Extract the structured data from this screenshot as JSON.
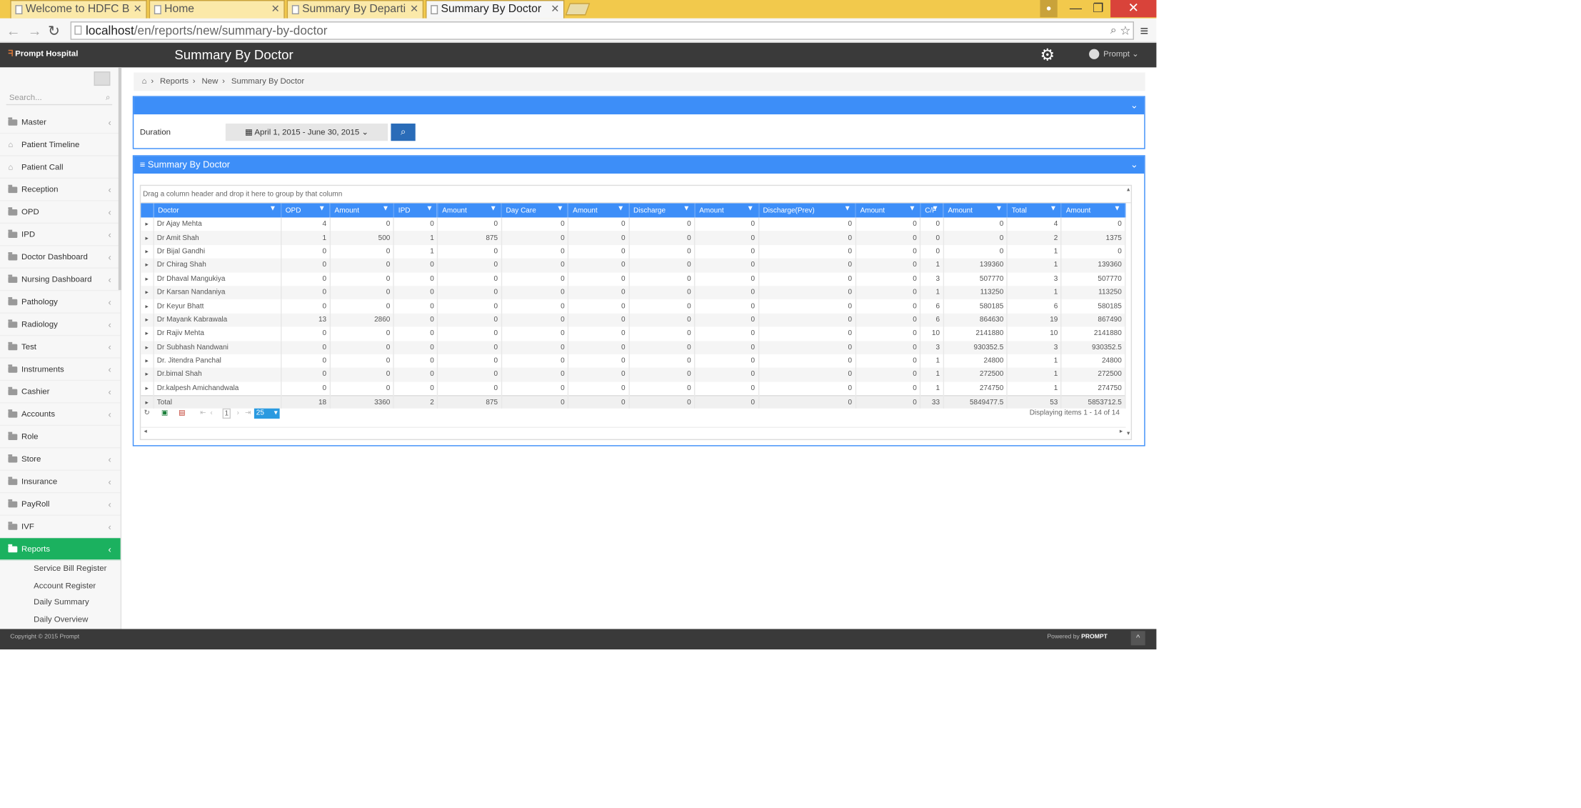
{
  "browser": {
    "tabs": [
      {
        "label": "Welcome to HDFC B"
      },
      {
        "label": "Home"
      },
      {
        "label": "Summary By Departi"
      },
      {
        "label": "Summary By Doctor"
      }
    ],
    "url_host": "localhost",
    "url_path": "/en/reports/new/summary-by-doctor"
  },
  "header": {
    "logo": "Prompt Hospital",
    "title": "Summary By Doctor",
    "user": "Prompt"
  },
  "sidebar": {
    "search_placeholder": "Search...",
    "items": [
      {
        "label": "Master",
        "icon": "folder-icon",
        "chev": "‹"
      },
      {
        "label": "Patient Timeline",
        "icon": "home-icon",
        "chev": ""
      },
      {
        "label": "Patient Call",
        "icon": "home-icon",
        "chev": ""
      },
      {
        "label": "Reception",
        "icon": "folder-icon",
        "chev": "‹"
      },
      {
        "label": "OPD",
        "icon": "folder-icon",
        "chev": "‹"
      },
      {
        "label": "IPD",
        "icon": "folder-icon",
        "chev": "‹"
      },
      {
        "label": "Doctor Dashboard",
        "icon": "folder-icon",
        "chev": "‹"
      },
      {
        "label": "Nursing Dashboard",
        "icon": "folder-icon",
        "chev": "‹"
      },
      {
        "label": "Pathology",
        "icon": "folder-icon",
        "chev": "‹"
      },
      {
        "label": "Radiology",
        "icon": "folder-icon",
        "chev": "‹"
      },
      {
        "label": "Test",
        "icon": "folder-icon",
        "chev": "‹"
      },
      {
        "label": "Instruments",
        "icon": "folder-icon",
        "chev": "‹"
      },
      {
        "label": "Cashier",
        "icon": "folder-icon",
        "chev": "‹"
      },
      {
        "label": "Accounts",
        "icon": "folder-icon",
        "chev": "‹"
      },
      {
        "label": "Role",
        "icon": "folder-icon",
        "chev": ""
      },
      {
        "label": "Store",
        "icon": "folder-icon",
        "chev": "‹"
      },
      {
        "label": "Insurance",
        "icon": "folder-icon",
        "chev": "‹"
      },
      {
        "label": "PayRoll",
        "icon": "folder-icon",
        "chev": "‹"
      },
      {
        "label": "IVF",
        "icon": "folder-icon",
        "chev": "‹"
      },
      {
        "label": "Reports",
        "icon": "folder-icon",
        "chev": "‹",
        "active": true
      }
    ],
    "subitems": [
      "Service Bill Register",
      "Account Register",
      "Daily Summary",
      "Daily Overview"
    ]
  },
  "breadcrumb": [
    "Reports",
    "New",
    "Summary By Doctor"
  ],
  "filter": {
    "duration_label": "Duration",
    "date_range": "April 1, 2015 - June 30, 2015"
  },
  "grid": {
    "title": "Summary By Doctor",
    "group_hint": "Drag a column header and drop it here to group by that column",
    "columns": [
      "Doctor",
      "OPD",
      "Amount",
      "IPD",
      "Amount",
      "Day Care",
      "Amount",
      "Discharge",
      "Amount",
      "Discharge(Prev)",
      "Amount",
      "C/F",
      "Amount",
      "Total",
      "Amount"
    ],
    "rows": [
      [
        "Dr Ajay Mehta",
        "4",
        "0",
        "0",
        "0",
        "0",
        "0",
        "0",
        "0",
        "0",
        "0",
        "0",
        "0",
        "4",
        "0"
      ],
      [
        "Dr Amit Shah",
        "1",
        "500",
        "1",
        "875",
        "0",
        "0",
        "0",
        "0",
        "0",
        "0",
        "0",
        "0",
        "2",
        "1375"
      ],
      [
        "Dr Bijal Gandhi",
        "0",
        "0",
        "1",
        "0",
        "0",
        "0",
        "0",
        "0",
        "0",
        "0",
        "0",
        "0",
        "1",
        "0"
      ],
      [
        "Dr Chirag Shah",
        "0",
        "0",
        "0",
        "0",
        "0",
        "0",
        "0",
        "0",
        "0",
        "0",
        "1",
        "139360",
        "1",
        "139360"
      ],
      [
        "Dr Dhaval Mangukiya",
        "0",
        "0",
        "0",
        "0",
        "0",
        "0",
        "0",
        "0",
        "0",
        "0",
        "3",
        "507770",
        "3",
        "507770"
      ],
      [
        "Dr Karsan Nandaniya",
        "0",
        "0",
        "0",
        "0",
        "0",
        "0",
        "0",
        "0",
        "0",
        "0",
        "1",
        "113250",
        "1",
        "113250"
      ],
      [
        "Dr Keyur Bhatt",
        "0",
        "0",
        "0",
        "0",
        "0",
        "0",
        "0",
        "0",
        "0",
        "0",
        "6",
        "580185",
        "6",
        "580185"
      ],
      [
        "Dr Mayank Kabrawala",
        "13",
        "2860",
        "0",
        "0",
        "0",
        "0",
        "0",
        "0",
        "0",
        "0",
        "6",
        "864630",
        "19",
        "867490"
      ],
      [
        "Dr Rajiv Mehta",
        "0",
        "0",
        "0",
        "0",
        "0",
        "0",
        "0",
        "0",
        "0",
        "0",
        "10",
        "2141880",
        "10",
        "2141880"
      ],
      [
        "Dr Subhash Nandwani",
        "0",
        "0",
        "0",
        "0",
        "0",
        "0",
        "0",
        "0",
        "0",
        "0",
        "3",
        "930352.5",
        "3",
        "930352.5"
      ],
      [
        "Dr. Jitendra Panchal",
        "0",
        "0",
        "0",
        "0",
        "0",
        "0",
        "0",
        "0",
        "0",
        "0",
        "1",
        "24800",
        "1",
        "24800"
      ],
      [
        "Dr.bimal Shah",
        "0",
        "0",
        "0",
        "0",
        "0",
        "0",
        "0",
        "0",
        "0",
        "0",
        "1",
        "272500",
        "1",
        "272500"
      ],
      [
        "Dr.kalpesh Amichandwala",
        "0",
        "0",
        "0",
        "0",
        "0",
        "0",
        "0",
        "0",
        "0",
        "0",
        "1",
        "274750",
        "1",
        "274750"
      ],
      [
        "Total",
        "18",
        "3360",
        "2",
        "875",
        "0",
        "0",
        "0",
        "0",
        "0",
        "0",
        "33",
        "5849477.5",
        "53",
        "5853712.5"
      ]
    ],
    "pager": {
      "page": "1",
      "page_size": "25",
      "info": "Displaying items 1 - 14 of 14"
    }
  },
  "footer": {
    "copyright": "Copyright © 2015 Prompt",
    "powered_prefix": "Powered by",
    "powered_brand": "PROMPT"
  },
  "colors": {
    "accent": "#3d8ef8",
    "active_menu": "#1bb15f",
    "header": "#3a3a3a"
  }
}
